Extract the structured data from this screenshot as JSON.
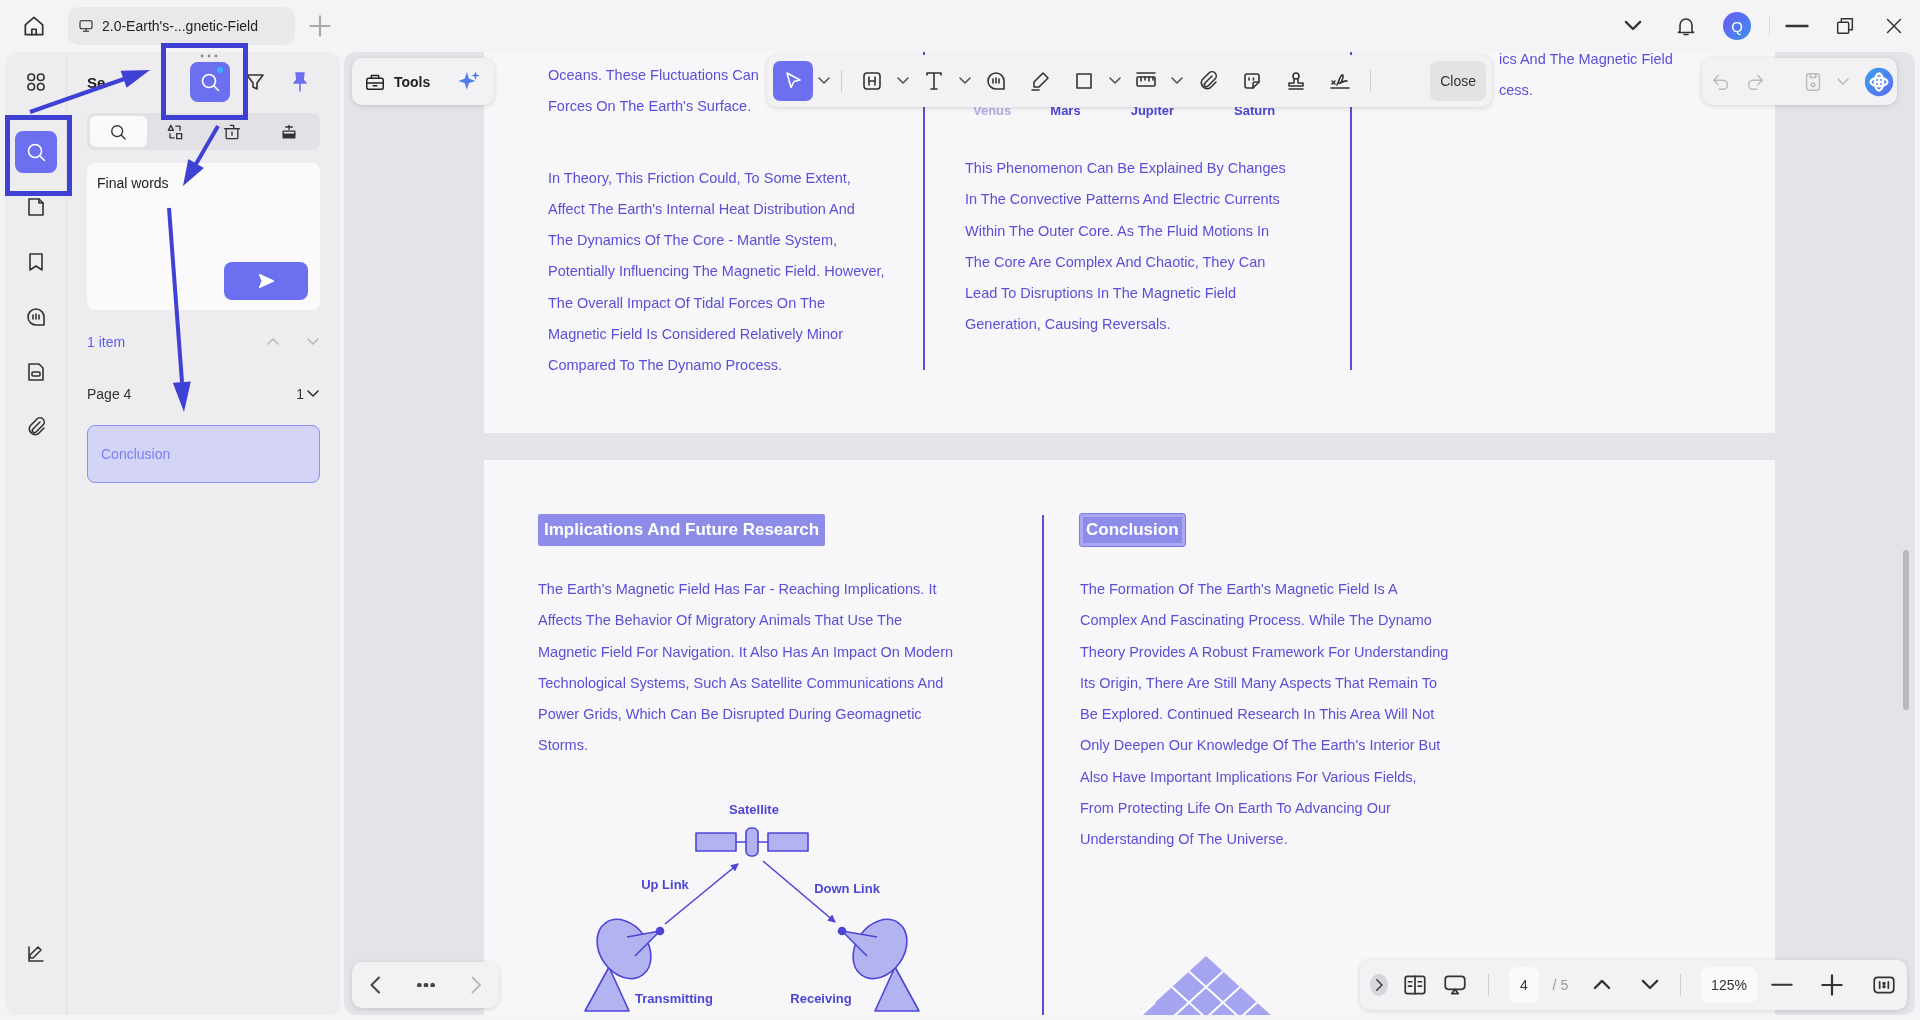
{
  "title_bar": {
    "tab_title": "2.0-Earth's-...gnetic-Field",
    "avatar": "Q"
  },
  "rail": {
    "items": [
      {
        "kind": "grid",
        "selected": false
      },
      {
        "kind": "search",
        "selected": true
      },
      {
        "kind": "page",
        "selected": false
      },
      {
        "kind": "bookmark",
        "selected": false
      },
      {
        "kind": "comment",
        "selected": false
      },
      {
        "kind": "form",
        "selected": false
      },
      {
        "kind": "clip",
        "selected": false
      }
    ],
    "bottom_items": [
      {
        "kind": "sign",
        "selected": false
      }
    ]
  },
  "search_panel": {
    "title": "Se",
    "header_tools": [
      {
        "kind": "search",
        "selected": true
      },
      {
        "kind": "filter",
        "selected": false
      },
      {
        "kind": "pin",
        "selected": true
      }
    ],
    "mode_tabs": [
      {
        "kind": "search",
        "selected": true
      },
      {
        "kind": "replace",
        "selected": false
      },
      {
        "kind": "clear",
        "selected": false
      },
      {
        "kind": "redact",
        "selected": false
      }
    ],
    "query": "Final words",
    "count": "1 item",
    "groups": [
      {
        "page": "Page 4",
        "count": "1",
        "expanded": true,
        "results": [
          {
            "text": "Conclusion",
            "selected": true
          }
        ]
      }
    ]
  },
  "tools_button": {
    "label": "Tools"
  },
  "annotation_toolbar": {
    "tools": [
      {
        "kind": "select",
        "selected": true,
        "menu": true
      },
      {
        "kind": "heading",
        "selected": false,
        "menu": true
      },
      {
        "kind": "text",
        "selected": false,
        "menu": true
      },
      {
        "kind": "comment",
        "selected": false,
        "menu": false
      },
      {
        "kind": "pen",
        "selected": false,
        "menu": false
      },
      {
        "kind": "square",
        "selected": false,
        "menu": true
      },
      {
        "kind": "measure",
        "selected": false,
        "menu": true
      },
      {
        "kind": "clip",
        "selected": false,
        "menu": false
      },
      {
        "kind": "sticker",
        "selected": false,
        "menu": false
      },
      {
        "kind": "stamp",
        "selected": false,
        "menu": false
      },
      {
        "kind": "sign",
        "selected": false,
        "menu": false
      }
    ],
    "close": "Close"
  },
  "quick_actions": [
    {
      "kind": "undo",
      "disabled": true,
      "menu": false
    },
    {
      "kind": "redo",
      "disabled": true,
      "menu": false
    },
    {
      "kind": "save",
      "disabled": true,
      "menu": true
    },
    {
      "kind": "ai",
      "disabled": false,
      "menu": false
    }
  ],
  "pages": [
    {
      "columns": [
        {
          "paragraphs": [
            {
              "lines": [
                "Oceans. These Fluctuations Can",
                "Forces On The Earth's Surface."
              ]
            },
            {
              "lines": [
                "In Theory, This Friction Could, To Some Extent,",
                "Affect The Earth's Internal Heat Distribution And",
                "The Dynamics Of The Core - Mantle System,",
                "Potentially Influencing The Magnetic Field. However,",
                "The Overall Impact Of Tidal Forces On The",
                "Magnetic Field Is Considered Relatively Minor",
                "Compared To The Dynamo Process."
              ]
            }
          ]
        },
        {
          "labels": [
            "Venus",
            "Mars",
            "Jupiter",
            "Saturn"
          ],
          "paragraphs": [
            {
              "lines": [
                "This Phenomenon Can Be Explained By Changes",
                "In The Convective Patterns And Electric Currents",
                "Within The Outer Core. As The Fluid Motions In",
                "The Core Are Complex And Chaotic, They Can",
                "Lead To Disruptions In The Magnetic Field",
                "Generation, Causing Reversals."
              ]
            }
          ]
        },
        {
          "paragraphs": [
            {
              "lines": [
                "ics And The Magnetic Field",
                "cess."
              ]
            }
          ]
        }
      ]
    },
    {
      "columns": [
        {
          "heading": {
            "text": "Implications And Future Research",
            "search_hit": false
          },
          "paragraphs": [
            {
              "lines": [
                "The Earth's Magnetic Field Has Far - Reaching Implications. It",
                "Affects The Behavior Of Migratory Animals That Use The",
                "Magnetic Field For Navigation. It Also Has An Impact On Modern",
                "Technological Systems, Such As Satellite Communications And",
                "Power Grids, Which Can Be Disrupted During Geomagnetic",
                "Storms."
              ]
            }
          ],
          "diagram": {
            "labels": [
              "Satellite",
              "Up Link",
              "Down Link",
              "Transmitting",
              "Receiving"
            ]
          }
        },
        {
          "heading": {
            "text": "Conclusion",
            "search_hit": true
          },
          "paragraphs": [
            {
              "lines": [
                "The Formation Of The Earth's Magnetic Field Is A",
                "Complex And Fascinating Process. While The Dynamo",
                "Theory Provides A Robust Framework For Understanding",
                "Its Origin, There Are Still Many Aspects That Remain To",
                "Be Explored. Continued Research In This Area Will Not",
                "Only Deepen Our Knowledge Of The Earth's Interior But",
                "Also Have Important Implications For Various Fields,",
                "From Protecting Life On Earth To Advancing Our",
                "Understanding Of The Universe."
              ]
            }
          ]
        }
      ]
    }
  ],
  "page_nav": {
    "current": "4",
    "total": "/ 5",
    "zoom": "125%"
  }
}
